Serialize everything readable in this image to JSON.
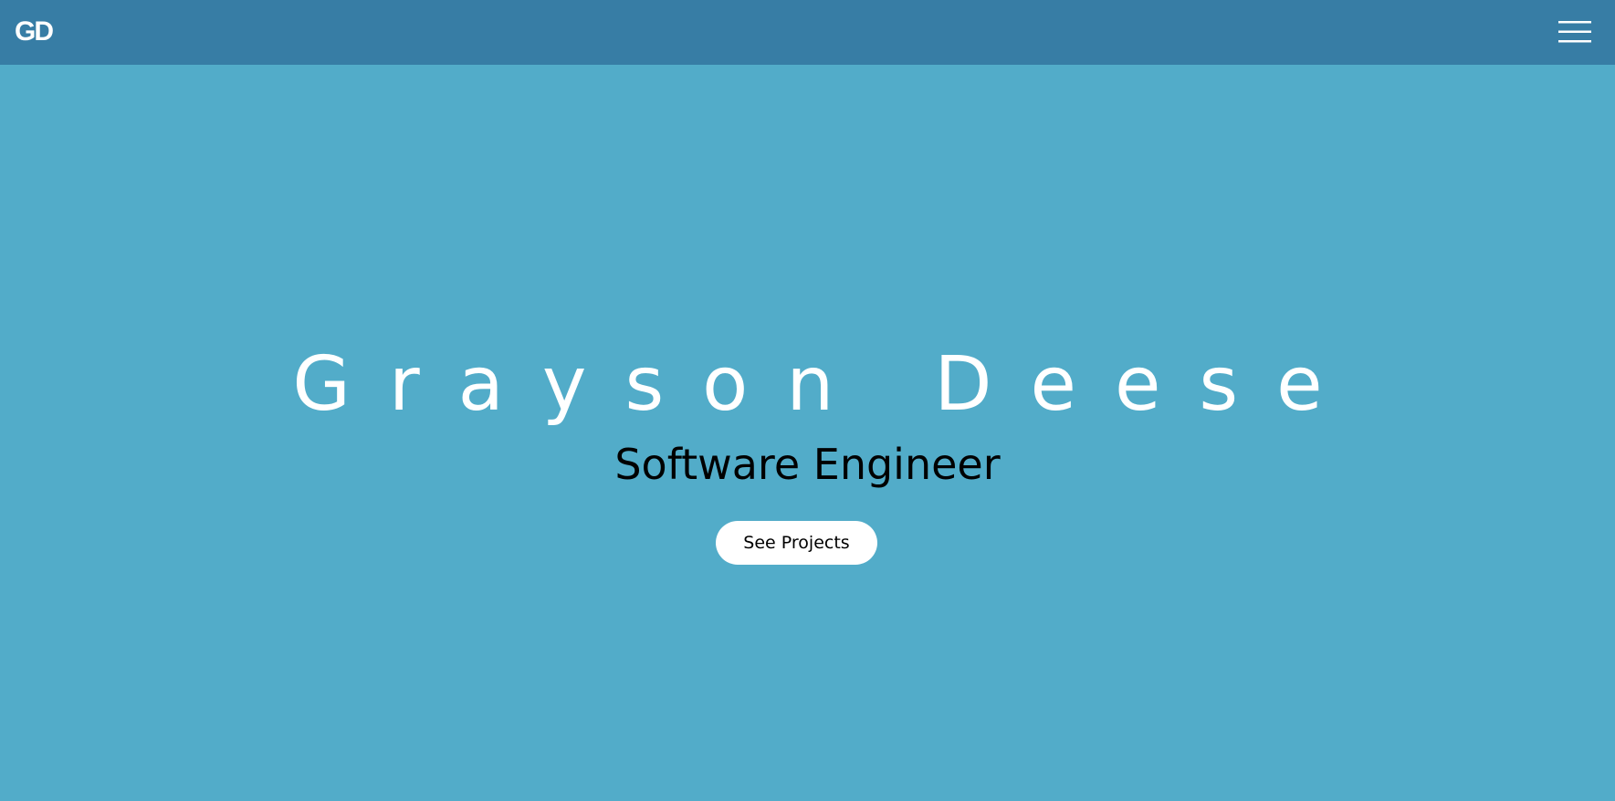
{
  "header": {
    "logo_text": "GD",
    "menu_icon": "hamburger-menu-icon"
  },
  "hero": {
    "name": "Grayson Deese",
    "subtitle": "Software Engineer",
    "cta_label": "See Projects"
  },
  "colors": {
    "header_background": "#377da5",
    "page_background": "#52acc9",
    "name_text": "#ffffff",
    "subtitle_text": "#000000",
    "button_background": "#ffffff"
  }
}
